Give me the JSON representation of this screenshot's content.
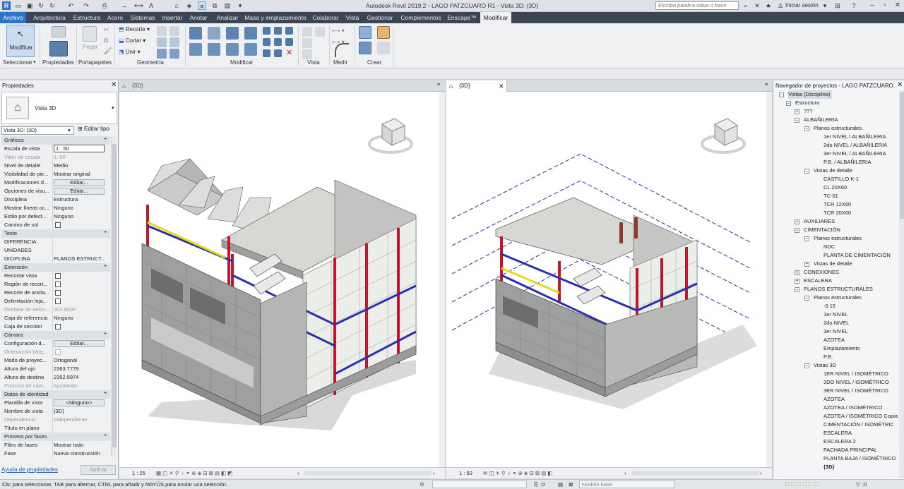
{
  "window": {
    "title": "Autodesk Revit 2019.2 - LAGO PATZCUARO R1 - Vista 3D: {3D}",
    "search_placeholder": "Escriba palabra clave o frase",
    "signin": "Iniciar sesión"
  },
  "tabs": [
    "Archivo",
    "Arquitectura",
    "Estructura",
    "Acero",
    "Sistemas",
    "Insertar",
    "Anotar",
    "Analizar",
    "Masa y emplazamiento",
    "Colaborar",
    "Vista",
    "Gestionar",
    "Complementos",
    "Enscape™",
    "Modificar"
  ],
  "ribbon": {
    "modify_label": "Modificar",
    "paste_label": "Pegar",
    "cut_label": "Recorte",
    "cut2_label": "Cortar",
    "join_label": "Unir",
    "panels": [
      "Seleccionar",
      "Propiedades",
      "Portapapeles",
      "Geometría",
      "Modificar",
      "Vista",
      "Medir",
      "Crear"
    ]
  },
  "properties": {
    "title": "Propiedades",
    "type_name": "Vista 3D",
    "selector": "Vista 3D: {3D}",
    "edit_type": "Editar tipo",
    "rows": [
      {
        "k": "Gráficos",
        "v": "",
        "kind": "section"
      },
      {
        "k": "Escala de vista",
        "v": "1 : 50",
        "kind": "input"
      },
      {
        "k": "Valor de escala",
        "v": "1:  50",
        "kind": "disabled"
      },
      {
        "k": "Nivel de detalle",
        "v": "Medio",
        "kind": "value"
      },
      {
        "k": "Visibilidad de pie...",
        "v": "Mostrar original",
        "kind": "value"
      },
      {
        "k": "Modificaciones d...",
        "v": "Editar...",
        "kind": "button"
      },
      {
        "k": "Opciones de visu...",
        "v": "Editar...",
        "kind": "button"
      },
      {
        "k": "Disciplina",
        "v": "Estructura",
        "kind": "value"
      },
      {
        "k": "Mostrar líneas oc...",
        "v": "Ninguno",
        "kind": "value"
      },
      {
        "k": "Estilo por defect...",
        "v": "Ninguno",
        "kind": "value"
      },
      {
        "k": "Camino de sol",
        "v": "",
        "kind": "check"
      },
      {
        "k": "Texto",
        "v": "",
        "kind": "section"
      },
      {
        "k": "DIFERENCIA",
        "v": "",
        "kind": "value"
      },
      {
        "k": "UNIDADES",
        "v": "",
        "kind": "value"
      },
      {
        "k": "DICIPLINA",
        "v": "PLANOS ESTRUCT...",
        "kind": "value"
      },
      {
        "k": "Extensión",
        "v": "",
        "kind": "section"
      },
      {
        "k": "Recortar vista",
        "v": "",
        "kind": "check"
      },
      {
        "k": "Región de recort...",
        "v": "",
        "kind": "check"
      },
      {
        "k": "Recorte de anota...",
        "v": "",
        "kind": "check"
      },
      {
        "k": "Delimitación leja...",
        "v": "",
        "kind": "check"
      },
      {
        "k": "Desfase de delim...",
        "v": "304.8000",
        "kind": "disabled"
      },
      {
        "k": "Caja de referencia",
        "v": "Ninguno",
        "kind": "value"
      },
      {
        "k": "Caja de sección",
        "v": "",
        "kind": "check"
      },
      {
        "k": "Cámara",
        "v": "",
        "kind": "section"
      },
      {
        "k": "Configuración d...",
        "v": "Editar...",
        "kind": "button"
      },
      {
        "k": "Orientación bloq...",
        "v": "",
        "kind": "check-dis"
      },
      {
        "k": "Modo de proyec...",
        "v": "Ortogonal",
        "kind": "value"
      },
      {
        "k": "Altura del ojo",
        "v": "2363.7779",
        "kind": "value"
      },
      {
        "k": "Altura de destino",
        "v": "2352.5974",
        "kind": "value"
      },
      {
        "k": "Posición de cám...",
        "v": "Ajustando",
        "kind": "disabled"
      },
      {
        "k": "Datos de identidad",
        "v": "",
        "kind": "section"
      },
      {
        "k": "Plantilla de vista",
        "v": "<Ninguno>",
        "kind": "button"
      },
      {
        "k": "Nombre de vista",
        "v": "{3D}",
        "kind": "value"
      },
      {
        "k": "Dependencia",
        "v": "Independiente",
        "kind": "disabled"
      },
      {
        "k": "Título en plano",
        "v": "",
        "kind": "value"
      },
      {
        "k": "Proceso por fases",
        "v": "",
        "kind": "section"
      },
      {
        "k": "Filtro de fases",
        "v": "Mostrar todo",
        "kind": "value"
      },
      {
        "k": "Fase",
        "v": "Nueva construcción",
        "kind": "value"
      }
    ],
    "help_link": "Ayuda de propiedades",
    "apply": "Aplicar"
  },
  "views": [
    {
      "tab": "{3D}",
      "scale": "1 : 25"
    },
    {
      "tab": "{3D}",
      "scale": "1 : 50"
    }
  ],
  "browser": {
    "title": "Navegador de proyectos - LAGO PATZCUARO...",
    "items": [
      {
        "t": "Vistas (Disciplina)",
        "lv": 0,
        "exp": "-",
        "sel": true
      },
      {
        "t": "Estructura",
        "lv": 1,
        "exp": "-"
      },
      {
        "t": "???",
        "lv": 2,
        "exp": "+"
      },
      {
        "t": "ALBAÑILERIA",
        "lv": 2,
        "exp": "-"
      },
      {
        "t": "Planos estructurales",
        "lv": 3,
        "exp": "-"
      },
      {
        "t": "1er NIVEL / ALBAÑILERIA",
        "lv": 4
      },
      {
        "t": "2do NIVEL / ALBAÑILERIA",
        "lv": 4
      },
      {
        "t": "3er NIVEL / ALBAÑILERIA",
        "lv": 4
      },
      {
        "t": "P.B. / ALBAÑILERIA",
        "lv": 4
      },
      {
        "t": "Vistas de detalle",
        "lv": 3,
        "exp": "-"
      },
      {
        "t": "CASTILLO K-1",
        "lv": 4
      },
      {
        "t": "CL 20X60",
        "lv": 4
      },
      {
        "t": "TC-01",
        "lv": 4
      },
      {
        "t": "TCR 12X60",
        "lv": 4
      },
      {
        "t": "TCR 20X60",
        "lv": 4
      },
      {
        "t": "AUXILIARES",
        "lv": 2,
        "exp": "+"
      },
      {
        "t": "CIMENTACIÓN",
        "lv": 2,
        "exp": "-"
      },
      {
        "t": "Planos estructurales",
        "lv": 3,
        "exp": "-"
      },
      {
        "t": "NDC",
        "lv": 4
      },
      {
        "t": "PLANTA DE CIMENTACIÓN",
        "lv": 4
      },
      {
        "t": "Vistas de detalle",
        "lv": 3,
        "exp": "+"
      },
      {
        "t": "CONEXIONES",
        "lv": 2,
        "exp": "+"
      },
      {
        "t": "ESCALERA",
        "lv": 2,
        "exp": "+"
      },
      {
        "t": "PLANOS ESTRUCTURALES",
        "lv": 2,
        "exp": "-"
      },
      {
        "t": "Planos estructurales",
        "lv": 3,
        "exp": "-"
      },
      {
        "t": "-0.15",
        "lv": 4
      },
      {
        "t": "1er NIVEL",
        "lv": 4
      },
      {
        "t": "2do NIVEL",
        "lv": 4
      },
      {
        "t": "3er NIVEL",
        "lv": 4
      },
      {
        "t": "AZOTEA",
        "lv": 4
      },
      {
        "t": "Emplazamiento",
        "lv": 4
      },
      {
        "t": "P.B.",
        "lv": 4
      },
      {
        "t": "Vistas 3D",
        "lv": 3,
        "exp": "-"
      },
      {
        "t": "1ER NIVEL / ISOMÉTRICO",
        "lv": 4
      },
      {
        "t": "2DO NIVEL / ISOMÉTRICO",
        "lv": 4
      },
      {
        "t": "3ER NIVEL / ISOMÉTRICO",
        "lv": 4
      },
      {
        "t": "AZOTEA",
        "lv": 4
      },
      {
        "t": "AZOTEA / ISOMÉTRICO",
        "lv": 4
      },
      {
        "t": "AZOTEA / ISOMÉTRICO Copia",
        "lv": 4
      },
      {
        "t": "CIMENTACIÓN / ISOMÉTRIC",
        "lv": 4
      },
      {
        "t": "ESCALERA",
        "lv": 4
      },
      {
        "t": "ESCALERA 2",
        "lv": 4
      },
      {
        "t": "FACHADA PRINCIPAL",
        "lv": 4
      },
      {
        "t": "PLANTA BAJA / ISOMÉTRICO",
        "lv": 4
      },
      {
        "t": "{3D}",
        "lv": 4,
        "bold": true
      }
    ]
  },
  "statusbar": {
    "hint": "Clic para seleccionar, TAB para alternar, CTRL para añadir y MAYÚS para anular una selección.",
    "count": ":0",
    "model": "Modelo base",
    "filter_count": ":0"
  },
  "colors": {
    "accent": "#2b74c9",
    "tabbar": "#3b4553",
    "beam_red": "#c4162a",
    "beam_blue": "#2b2fae",
    "beam_yellow": "#e7d91a",
    "wall": "#9ea09f",
    "slab": "#d6d8d4"
  }
}
